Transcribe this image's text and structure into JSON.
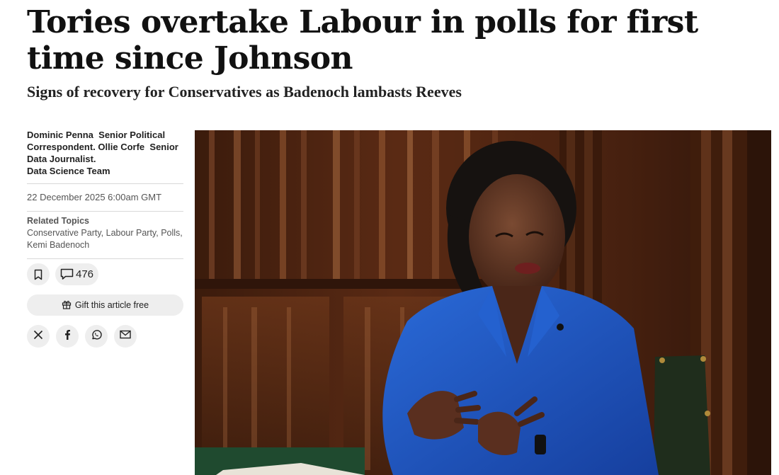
{
  "article": {
    "headline": "Tories overtake Labour in polls for first time since Johnson",
    "standfirst": "Signs of recovery for Conservatives as Badenoch lambasts Reeves"
  },
  "byline": {
    "author1": "Dominic Penna",
    "author1_role": "Senior Political Correspondent.",
    "author2": "Ollie Corfe",
    "author2_role": "Senior Data Journalist.",
    "team": "Data Science Team"
  },
  "dateline": "22 December 2025 6:00am GMT",
  "related_topics": {
    "title": "Related Topics",
    "topics": "Conservative Party, Labour Party, Polls, Kemi Badenoch"
  },
  "actions": {
    "bookmark_icon": "bookmark-icon",
    "comment_icon": "comment-icon",
    "comment_count": "476",
    "gift_icon": "gift-icon",
    "gift_label": "Gift this article free"
  },
  "share": {
    "icons": [
      "x-icon",
      "facebook-icon",
      "whatsapp-icon",
      "email-icon"
    ]
  },
  "colors": {
    "panel_wood": "#4a2412",
    "blazer_blue": "#1f57c4",
    "pill_background": "#eeeeee"
  }
}
